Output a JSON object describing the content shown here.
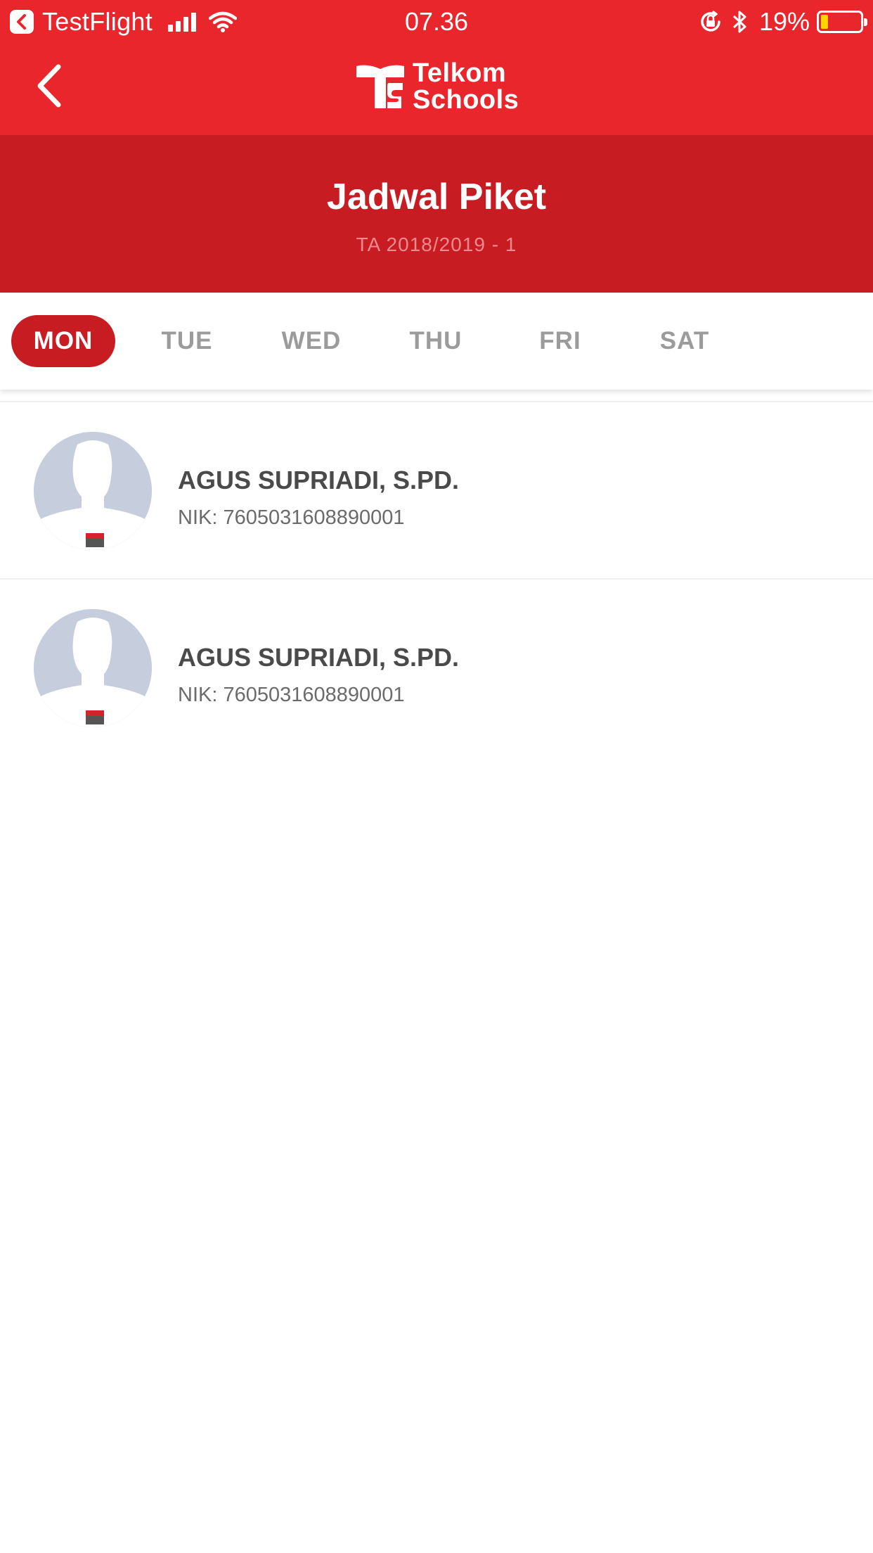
{
  "status_bar": {
    "app_name": "TestFlight",
    "time": "07.36",
    "battery_percent": "19%",
    "battery_level": 0.19,
    "icons": [
      "back-to-app-icon",
      "cellular-signal-icon",
      "wifi-icon",
      "orientation-lock-icon",
      "bluetooth-icon",
      "battery-icon"
    ]
  },
  "nav": {
    "back_icon": "chevron-left-icon",
    "logo": {
      "line1": "Telkom",
      "line2": "Schools"
    }
  },
  "header": {
    "title": "Jadwal Piket",
    "subtitle": "TA 2018/2019 - 1"
  },
  "day_tabs": [
    {
      "label": "MON",
      "active": true
    },
    {
      "label": "TUE",
      "active": false
    },
    {
      "label": "WED",
      "active": false
    },
    {
      "label": "THU",
      "active": false
    },
    {
      "label": "FRI",
      "active": false
    },
    {
      "label": "SAT",
      "active": false
    }
  ],
  "staff_list": [
    {
      "name": "AGUS SUPRIADI, S.PD.",
      "nik": "NIK: 7605031608890001"
    },
    {
      "name": "AGUS SUPRIADI, S.PD.",
      "nik": "NIK: 7605031608890001"
    }
  ],
  "colors": {
    "primary_red": "#e8262c",
    "header_red": "#c81c23",
    "tab_inactive": "#9b9b9b",
    "battery_fill": "#ffd400"
  }
}
